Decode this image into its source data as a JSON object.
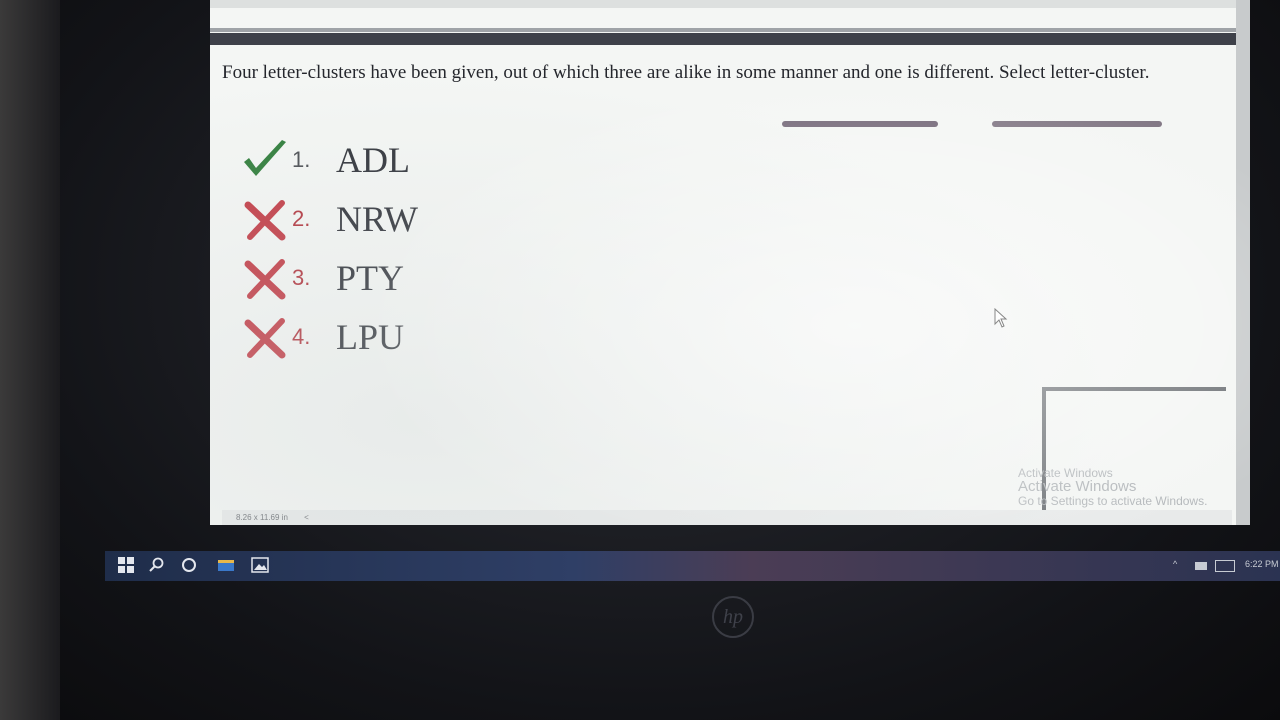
{
  "question": {
    "text": "Four letter-clusters have been given, out of which three are alike in some manner and one is different. Select letter-cluster."
  },
  "options": [
    {
      "number": "1.",
      "text": "ADL",
      "status": "correct"
    },
    {
      "number": "2.",
      "text": "NRW",
      "status": "wrong"
    },
    {
      "number": "3.",
      "text": "PTY",
      "status": "wrong"
    },
    {
      "number": "4.",
      "text": "LPU",
      "status": "wrong"
    }
  ],
  "status_bar": {
    "page_size": "8.26 x 11.69 in",
    "scroll_left": "<"
  },
  "watermark": {
    "line1": "Activate Windows",
    "line2": "Activate Windows",
    "line3": "Go to Settings to activate Windows."
  },
  "taskbar": {
    "clock": "6:22 PM"
  },
  "colors": {
    "correct": "#2f7d3a",
    "wrong": "#c23a44",
    "text": "#24262c"
  },
  "icons": {
    "correct_mark": "check-icon",
    "wrong_mark": "cross-icon"
  }
}
